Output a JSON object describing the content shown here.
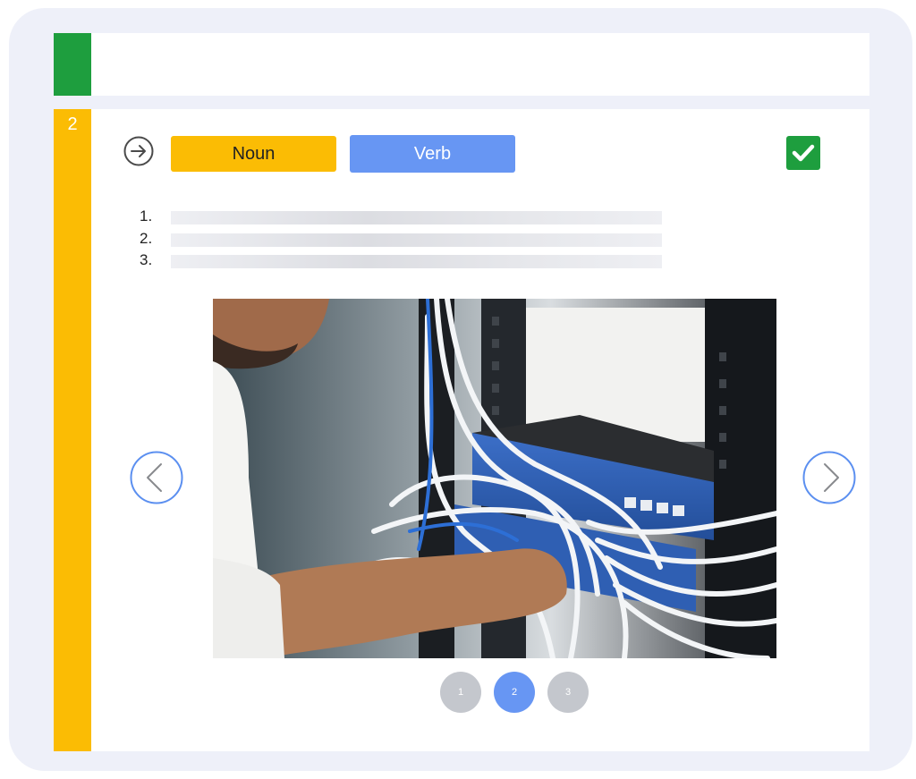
{
  "colors": {
    "frame": "#eef0f9",
    "green": "#1e9e3e",
    "yellow": "#fbbc04",
    "blue": "#6796f3",
    "dot_inactive": "#c4c7cd",
    "nav": "#5b8ff0"
  },
  "step": {
    "number": "2"
  },
  "buttons": {
    "noun_label": "Noun",
    "verb_label": "Verb"
  },
  "list": {
    "items": [
      {
        "num": "1."
      },
      {
        "num": "2."
      },
      {
        "num": "3."
      }
    ]
  },
  "icons": {
    "arrow": "arrow-right-circle-icon",
    "check": "check-icon",
    "prev": "chevron-left-icon",
    "next": "chevron-right-icon"
  },
  "pager": {
    "pages": [
      "1",
      "2",
      "3"
    ],
    "active": "2"
  }
}
